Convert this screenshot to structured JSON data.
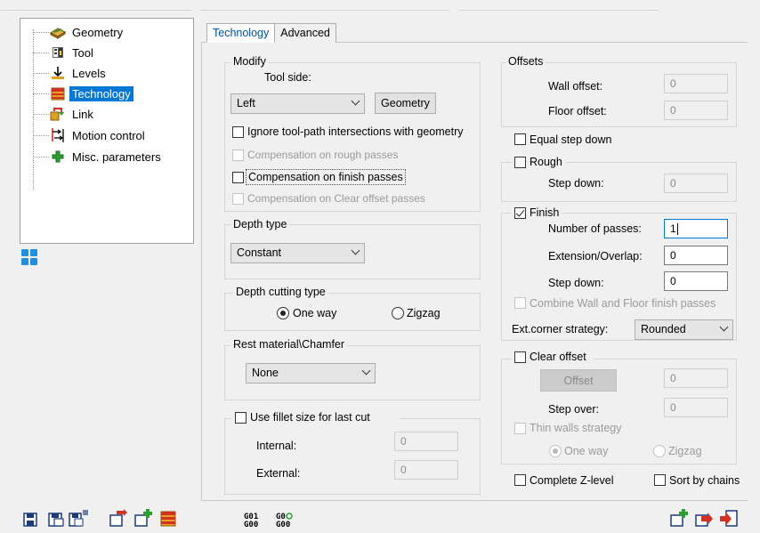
{
  "tree": {
    "items": [
      {
        "label": "Geometry",
        "icon": "geometry-icon"
      },
      {
        "label": "Tool",
        "icon": "tool-icon"
      },
      {
        "label": "Levels",
        "icon": "levels-icon"
      },
      {
        "label": "Technology",
        "icon": "technology-icon",
        "selected": true
      },
      {
        "label": "Link",
        "icon": "link-icon"
      },
      {
        "label": "Motion control",
        "icon": "motion-control-icon"
      },
      {
        "label": "Misc. parameters",
        "icon": "misc-parameters-icon"
      }
    ]
  },
  "tabs": [
    {
      "label": "Technology",
      "active": true
    },
    {
      "label": "Advanced",
      "active": false
    }
  ],
  "modify": {
    "title": "Modify",
    "tool_side_label": "Tool side:",
    "tool_side_value": "Left",
    "geometry_button": "Geometry",
    "ignore_intersections": {
      "label": "Ignore tool-path intersections with geometry",
      "checked": false,
      "enabled": true
    },
    "comp_rough": {
      "label": "Compensation on rough passes",
      "checked": false,
      "enabled": false
    },
    "comp_finish": {
      "label": "Compensation on finish passes",
      "checked": false,
      "enabled": true
    },
    "comp_clear": {
      "label": "Compensation on Clear offset passes",
      "checked": false,
      "enabled": false
    }
  },
  "depth_type": {
    "title": "Depth type",
    "value": "Constant"
  },
  "depth_cutting": {
    "title": "Depth cutting type",
    "options": [
      {
        "label": "One way",
        "selected": true
      },
      {
        "label": "Zigzag",
        "selected": false
      }
    ]
  },
  "rest_material": {
    "title": "Rest material\\Chamfer",
    "value": "None"
  },
  "fillet": {
    "label": "Use fillet size for last cut",
    "checked": false,
    "internal_label": "Internal:",
    "internal_value": "0",
    "external_label": "External:",
    "external_value": "0"
  },
  "offsets": {
    "title": "Offsets",
    "wall_label": "Wall offset:",
    "wall_value": "0",
    "floor_label": "Floor offset:",
    "floor_value": "0"
  },
  "equal_step": {
    "label": "Equal step down",
    "checked": false
  },
  "rough": {
    "label": "Rough",
    "checked": false,
    "step_label": "Step down:",
    "step_value": "0"
  },
  "finish": {
    "label": "Finish",
    "checked": true,
    "passes_label": "Number of passes:",
    "passes_value": "1",
    "ext_label": "Extension/Overlap:",
    "ext_value": "0",
    "step_label": "Step down:",
    "step_value": "0",
    "combine_label": "Combine Wall and Floor finish passes",
    "corner_label": "Ext.corner strategy:",
    "corner_value": "Rounded"
  },
  "clear_offset": {
    "label": "Clear offset",
    "checked": false,
    "offset_button": "Offset",
    "offset_value": "0",
    "step_over_label": "Step over:",
    "step_over_value": "0",
    "thin_walls_label": "Thin walls strategy",
    "one_way_label": "One way",
    "zigzag_label": "Zigzag"
  },
  "complete_z": {
    "label": "Complete Z-level",
    "checked": false
  },
  "sort_chains": {
    "label": "Sort by chains",
    "checked": false
  },
  "toolbar": {
    "gcode_1_top": "G01",
    "gcode_1_bottom": "G00",
    "gcode_2_top": "G0",
    "gcode_2_bottom": "G00"
  },
  "colors": {
    "selection": "#0078d7",
    "tab_active_text": "#0050a0",
    "focus_border": "#0078d7"
  }
}
